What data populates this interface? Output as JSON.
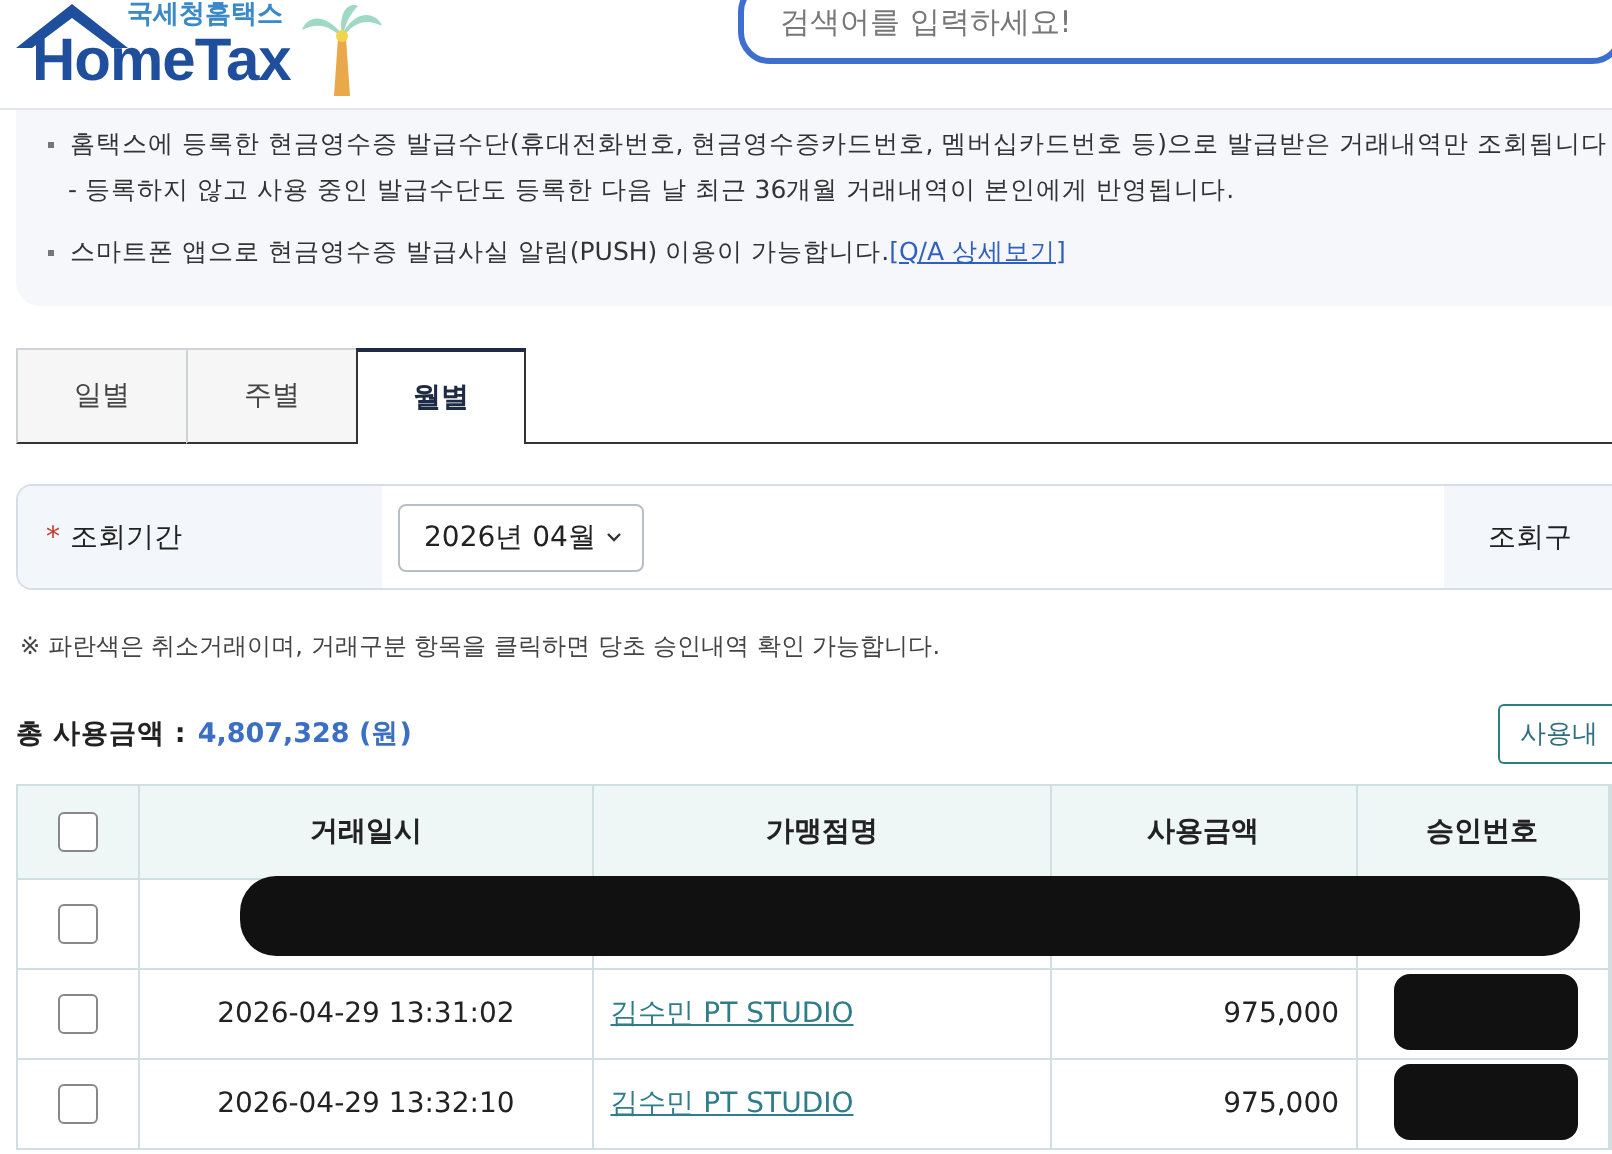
{
  "header": {
    "logo_caption": "국세청홈택스",
    "logo_text": "HomeTax",
    "search": {
      "placeholder": "검색어를 입력하세요!"
    }
  },
  "notice": {
    "items": [
      {
        "text": "홈택스에 등록한 현금영수증 발급수단(휴대전화번호, 현금영수증카드번호, 멤버십카드번호 등)으로 발급받은 거래내역만 조회됩니다",
        "sub": "- 등록하지 않고 사용 중인 발급수단도 등록한 다음 날 최근 36개월 거래내역이 본인에게 반영됩니다."
      },
      {
        "text": "스마트폰 앱으로 현금영수증 발급사실 알림(PUSH) 이용이 가능합니다.",
        "link": "[Q/A 상세보기]"
      }
    ]
  },
  "tabs": [
    {
      "label": "일별",
      "selected": false
    },
    {
      "label": "주별",
      "selected": false
    },
    {
      "label": "월별",
      "selected": true
    }
  ],
  "query": {
    "label": "조회기간",
    "required_mark": "*",
    "period": "2026년 04월",
    "label_2": "조회구"
  },
  "note": "※ 파란색은 취소거래이며, 거래구분 항목을 클릭하면 당초 승인내역 확인 가능합니다.",
  "total": {
    "label": "총 사용금액 :",
    "amount": "4,807,328 (원)",
    "button": "사용내"
  },
  "table": {
    "all_checked": false,
    "columns": [
      "거래일시",
      "가맹점명",
      "사용금액",
      "승인번호"
    ],
    "rows": [
      {
        "checked": false,
        "redacted": true
      },
      {
        "checked": false,
        "redacted": false,
        "date": "2026-04-29 13:31:02",
        "merchant": "김수민 PT STUDIO",
        "amount": "975,000"
      },
      {
        "checked": false,
        "redacted": false,
        "date": "2026-04-29 13:32:10",
        "merchant": "김수민 PT STUDIO",
        "amount": "975,000"
      }
    ]
  }
}
